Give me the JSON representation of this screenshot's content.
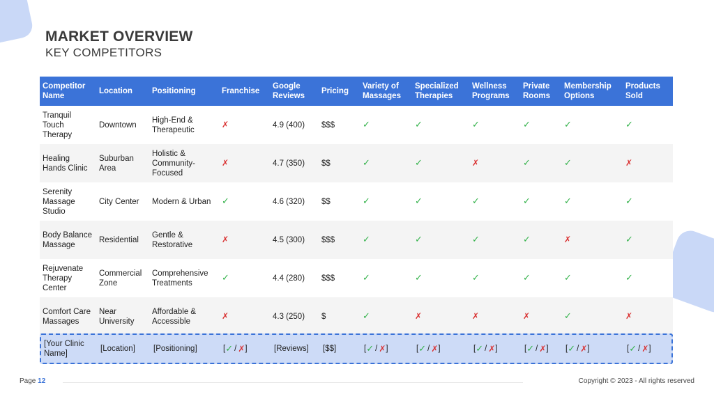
{
  "header": {
    "title": "MARKET OVERVIEW",
    "subtitle": "KEY COMPETITORS"
  },
  "table": {
    "columns": [
      "Competitor Name",
      "Location",
      "Positioning",
      "Franchise",
      "Google Reviews",
      "Pricing",
      "Variety of Massages",
      "Specialized Therapies",
      "Wellness Programs",
      "Private Rooms",
      "Membership Options",
      "Products Sold"
    ],
    "rows": [
      {
        "name": "Tranquil Touch Therapy",
        "location": "Downtown",
        "positioning": "High-End & Therapeutic",
        "franchise": "no",
        "reviews": "4.9 (400)",
        "pricing": "$$$",
        "variety": "yes",
        "specialized": "yes",
        "wellness": "yes",
        "private": "yes",
        "membership": "yes",
        "products": "yes"
      },
      {
        "name": "Healing Hands Clinic",
        "location": "Suburban Area",
        "positioning": "Holistic & Community-Focused",
        "franchise": "no",
        "reviews": "4.7 (350)",
        "pricing": "$$",
        "variety": "yes",
        "specialized": "yes",
        "wellness": "no",
        "private": "yes",
        "membership": "yes",
        "products": "no"
      },
      {
        "name": "Serenity Massage Studio",
        "location": "City Center",
        "positioning": "Modern & Urban",
        "franchise": "yes",
        "reviews": "4.6 (320)",
        "pricing": "$$",
        "variety": "yes",
        "specialized": "yes",
        "wellness": "yes",
        "private": "yes",
        "membership": "yes",
        "products": "yes"
      },
      {
        "name": "Body Balance Massage",
        "location": "Residential",
        "positioning": "Gentle & Restorative",
        "franchise": "no",
        "reviews": "4.5 (300)",
        "pricing": "$$$",
        "variety": "yes",
        "specialized": "yes",
        "wellness": "yes",
        "private": "yes",
        "membership": "no",
        "products": "yes"
      },
      {
        "name": "Rejuvenate Therapy Center",
        "location": "Commercial Zone",
        "positioning": "Comprehensive Treatments",
        "franchise": "yes",
        "reviews": "4.4 (280)",
        "pricing": "$$$",
        "variety": "yes",
        "specialized": "yes",
        "wellness": "yes",
        "private": "yes",
        "membership": "yes",
        "products": "yes"
      },
      {
        "name": "Comfort Care Massages",
        "location": "Near University",
        "positioning": "Affordable & Accessible",
        "franchise": "no",
        "reviews": "4.3 (250)",
        "pricing": "$",
        "variety": "yes",
        "specialized": "no",
        "wellness": "no",
        "private": "no",
        "membership": "yes",
        "products": "no"
      }
    ],
    "placeholder": {
      "name": "[Your Clinic Name]",
      "location": "[Location]",
      "positioning": "[Positioning]",
      "reviews": "[Reviews]",
      "pricing": "[$$]",
      "open": "[",
      "slash": "/",
      "close": "]"
    },
    "symbols": {
      "yes": "✓",
      "no": "✗"
    },
    "colors": {
      "yes": "#33b24a",
      "no": "#d93030",
      "header": "#3b73d8"
    }
  },
  "footer": {
    "page_label": "Page",
    "page_number": "12",
    "copyright": "Copyright © 2023 - All rights reserved"
  }
}
